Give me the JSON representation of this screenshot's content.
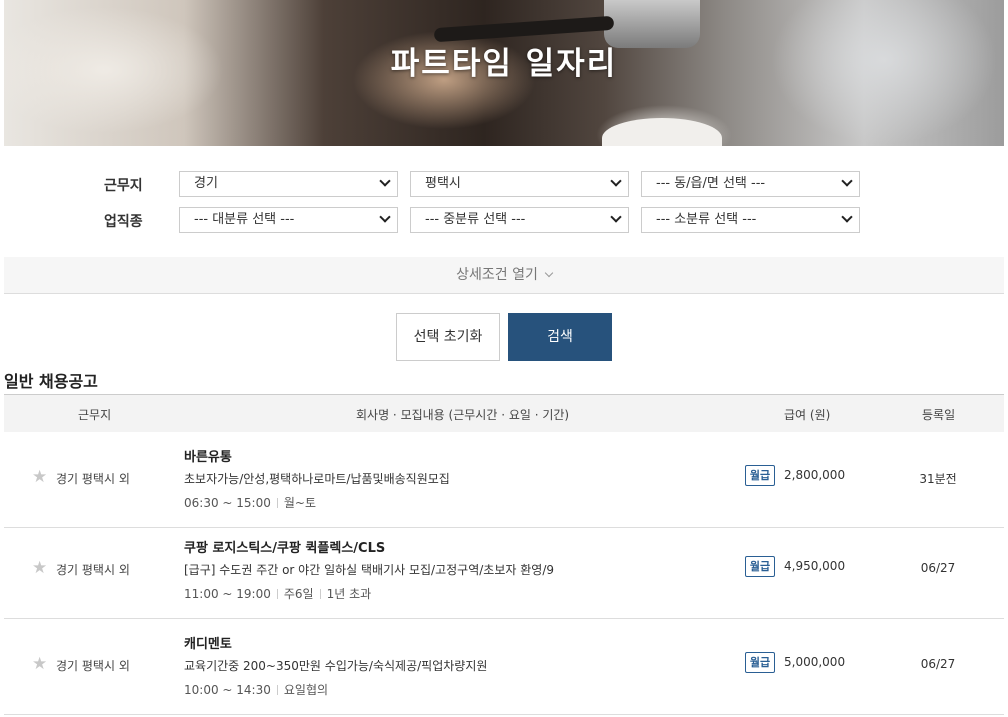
{
  "hero": {
    "title": "파트타임 일자리"
  },
  "filters": {
    "location_label": "근무지",
    "location": [
      "경기",
      "평택시",
      "--- 동/읍/면 선택 ---"
    ],
    "job_label": "업직종",
    "job": [
      "--- 대분류 선택 ---",
      "--- 중분류 선택 ---",
      "--- 소분류 선택 ---"
    ]
  },
  "detail_toggle": "상세조건 열기",
  "buttons": {
    "reset": "선택 초기화",
    "search": "검색"
  },
  "section_title": "일반 채용공고",
  "table": {
    "headers": [
      "근무지",
      "회사명 · 모집내용 (근무시간 · 요일 · 기간)",
      "급여 (원)",
      "등록일"
    ],
    "rows": [
      {
        "location": "경기 평택시 외",
        "company": "바른유통",
        "description": "초보자가능/안성,평택하나로마트/납품및배송직원모집",
        "time": "06:30 ~ 15:00",
        "days": "월~토",
        "period": "",
        "pay_type": "월급",
        "amount": "2,800,000",
        "date": "31분전"
      },
      {
        "location": "경기 평택시 외",
        "company": "쿠팡 로지스틱스/쿠팡 퀵플렉스/CLS",
        "description": "[급구] 수도권 주간 or 야간 일하실 택배기사 모집/고정구역/초보자 환영/9",
        "time": "11:00 ~ 19:00",
        "days": "주6일",
        "period": "1년 초과",
        "pay_type": "월급",
        "amount": "4,950,000",
        "date": "06/27"
      },
      {
        "location": "경기 평택시 외",
        "company": "캐디멘토",
        "description": "교육기간중 200~350만원 수입가능/숙식제공/픽업차량지원",
        "time": "10:00 ~ 14:30",
        "days": "요일협의",
        "period": "",
        "pay_type": "월급",
        "amount": "5,000,000",
        "date": "06/27"
      }
    ]
  },
  "icons": {
    "favorite": "star-icon",
    "dropdown": "chevron-down-icon"
  }
}
